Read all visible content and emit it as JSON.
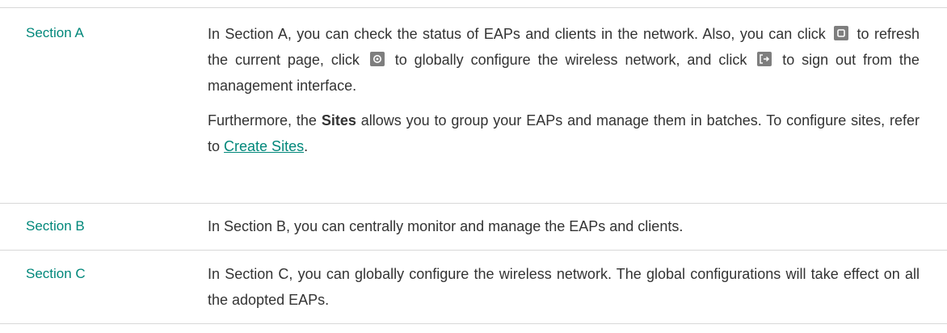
{
  "rows": [
    {
      "label": "Section A",
      "para1": {
        "part1": "In Section A, you can check the status of EAPs and clients in the network. Also, you can click",
        "part2": "to refresh the current page, click",
        "part3": "to globally configure the wireless network, and click",
        "part4": "to sign out from the management interface.",
        "icons": [
          "refresh-icon",
          "settings-icon",
          "sign-out-icon"
        ]
      },
      "para2": {
        "part1": "Furthermore, the",
        "bold": "Sites",
        "part2": "allows you to group your EAPs and manage them in batches. To configure sites, refer to",
        "link": "Create Sites",
        "part3": "."
      }
    },
    {
      "label": "Section B",
      "text": "In Section B, you can centrally monitor and manage the EAPs and clients."
    },
    {
      "label": "Section C",
      "text": "In Section C, you can globally configure the wireless network. The global configurations will take effect on all the adopted EAPs."
    }
  ],
  "colors": {
    "label": "#00877a",
    "body_text": "#333333",
    "divider": "#d8d8d8",
    "icon_bg": "#7e7e7e"
  }
}
